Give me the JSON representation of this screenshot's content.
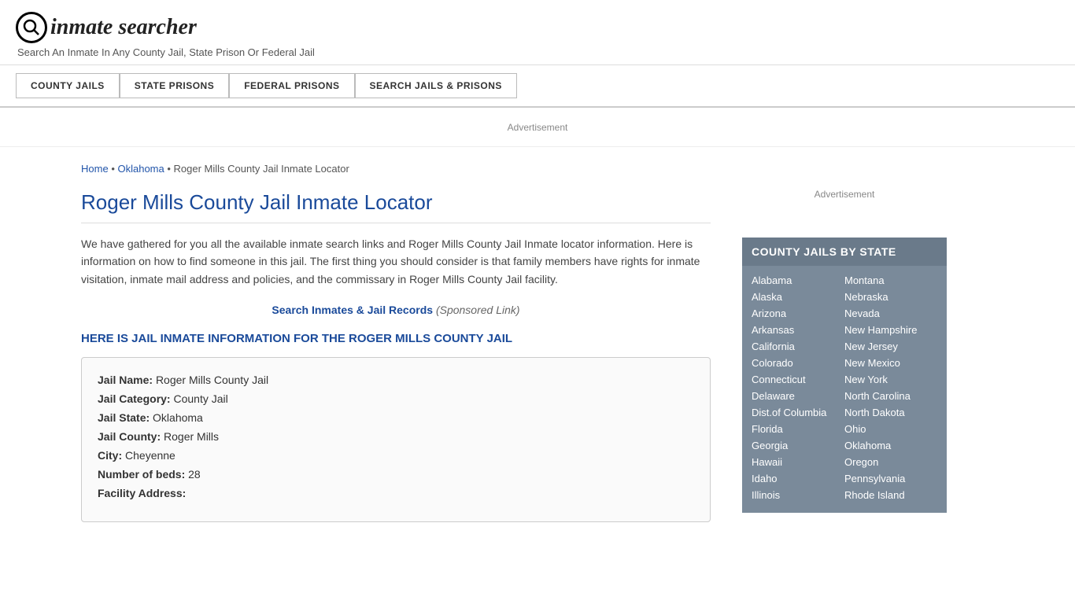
{
  "header": {
    "logo_icon": "🔍",
    "logo_text": "inmate searcher",
    "tagline": "Search An Inmate In Any County Jail, State Prison Or Federal Jail"
  },
  "nav": {
    "items": [
      {
        "label": "COUNTY JAILS",
        "name": "county-jails"
      },
      {
        "label": "STATE PRISONS",
        "name": "state-prisons"
      },
      {
        "label": "FEDERAL PRISONS",
        "name": "federal-prisons"
      },
      {
        "label": "SEARCH JAILS & PRISONS",
        "name": "search-jails-prisons"
      }
    ]
  },
  "ad": {
    "label": "Advertisement"
  },
  "breadcrumb": {
    "home": "Home",
    "state": "Oklahoma",
    "current": "Roger Mills County Jail Inmate Locator"
  },
  "page": {
    "title": "Roger Mills County Jail Inmate Locator",
    "description": "We have gathered for you all the available inmate search links and Roger Mills County Jail Inmate locator information. Here is information on how to find someone in this jail. The first thing you should consider is that family members have rights for inmate visitation, inmate mail address and policies, and the commissary in Roger Mills County Jail facility.",
    "search_link_text": "Search Inmates & Jail Records",
    "search_link_sponsored": "(Sponsored Link)",
    "jail_info_header": "HERE IS JAIL INMATE INFORMATION FOR THE ROGER MILLS COUNTY JAIL"
  },
  "jail_info": {
    "name_label": "Jail Name:",
    "name_value": "Roger Mills County Jail",
    "category_label": "Jail Category:",
    "category_value": "County Jail",
    "state_label": "Jail State:",
    "state_value": "Oklahoma",
    "county_label": "Jail County:",
    "county_value": "Roger Mills",
    "city_label": "City:",
    "city_value": "Cheyenne",
    "beds_label": "Number of beds:",
    "beds_value": "28",
    "address_label": "Facility Address:"
  },
  "sidebar": {
    "ad_label": "Advertisement",
    "state_box_title": "COUNTY JAILS BY STATE",
    "states_left": [
      "Alabama",
      "Alaska",
      "Arizona",
      "Arkansas",
      "California",
      "Colorado",
      "Connecticut",
      "Delaware",
      "Dist.of Columbia",
      "Florida",
      "Georgia",
      "Hawaii",
      "Idaho",
      "Illinois"
    ],
    "states_right": [
      "Montana",
      "Nebraska",
      "Nevada",
      "New Hampshire",
      "New Jersey",
      "New Mexico",
      "New York",
      "North Carolina",
      "North Dakota",
      "Ohio",
      "Oklahoma",
      "Oregon",
      "Pennsylvania",
      "Rhode Island"
    ]
  }
}
